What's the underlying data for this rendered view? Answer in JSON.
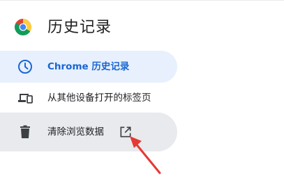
{
  "app": {
    "page_title": "历史记录"
  },
  "sidebar": {
    "items": [
      {
        "label": "Chrome 历史记录",
        "icon": "clock-icon",
        "selected": true
      },
      {
        "label": "从其他设备打开的标签页",
        "icon": "devices-icon",
        "selected": false
      },
      {
        "label": "清除浏览数据",
        "icon": "trash-icon",
        "selected": false,
        "trailing_icon": "open-in-new-icon"
      }
    ]
  },
  "colors": {
    "accent": "#1967d2",
    "selected_bg": "#e8f0fe",
    "hover_bg": "#e8eaed",
    "annotation_arrow": "#e53935"
  }
}
